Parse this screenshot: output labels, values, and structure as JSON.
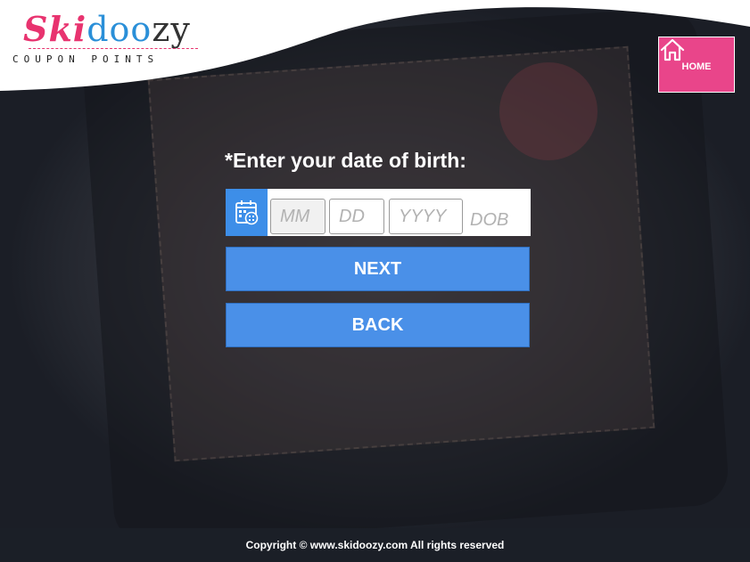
{
  "header": {
    "logo": {
      "brand_part1": "Ski",
      "brand_part2": "doo",
      "brand_part3": "zy",
      "tagline": "COUPON POINTS"
    },
    "home": {
      "label": "HOME",
      "icon": "home-icon"
    }
  },
  "form": {
    "title": "*Enter your date of birth:",
    "calendar_icon": "calendar-icon",
    "month": {
      "value": "",
      "placeholder": "MM"
    },
    "day": {
      "value": "",
      "placeholder": "DD"
    },
    "year": {
      "value": "",
      "placeholder": "YYYY"
    },
    "dob_label": "DOB",
    "next_label": "NEXT",
    "back_label": "BACK"
  },
  "footer": {
    "copyright": "Copyright © www.skidoozy.com All rights reserved"
  },
  "colors": {
    "accent_pink": "#e9458a",
    "button_blue": "#4a90e8",
    "calendar_blue": "#3d8ee8",
    "footer_bg": "#1b1f27"
  }
}
